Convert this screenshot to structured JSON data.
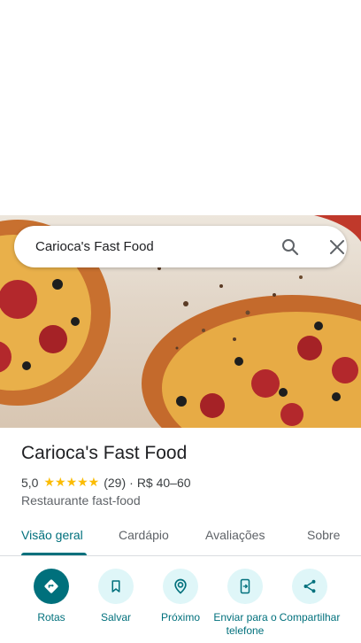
{
  "search": {
    "query": "Carioca's Fast Food"
  },
  "place": {
    "name": "Carioca's Fast Food",
    "rating": "5,0",
    "stars": "★★★★★",
    "reviews": "(29)",
    "separator": "·",
    "price": "R$ 40–60",
    "category": "Restaurante fast-food"
  },
  "tabs": [
    {
      "label": "Visão geral",
      "active": true
    },
    {
      "label": "Cardápio",
      "active": false
    },
    {
      "label": "Avaliações",
      "active": false
    },
    {
      "label": "Sobre",
      "active": false
    }
  ],
  "actions": [
    {
      "label": "Rotas",
      "icon": "directions-icon"
    },
    {
      "label": "Salvar",
      "icon": "bookmark-icon"
    },
    {
      "label": "Próximo",
      "icon": "nearby-icon"
    },
    {
      "label": "Enviar para o telefone",
      "icon": "send-to-phone-icon"
    },
    {
      "label": "Compartilhar",
      "icon": "share-icon"
    }
  ],
  "colors": {
    "accent": "#00707c",
    "action_bg": "#dff6f8",
    "star": "#fbbc04"
  }
}
